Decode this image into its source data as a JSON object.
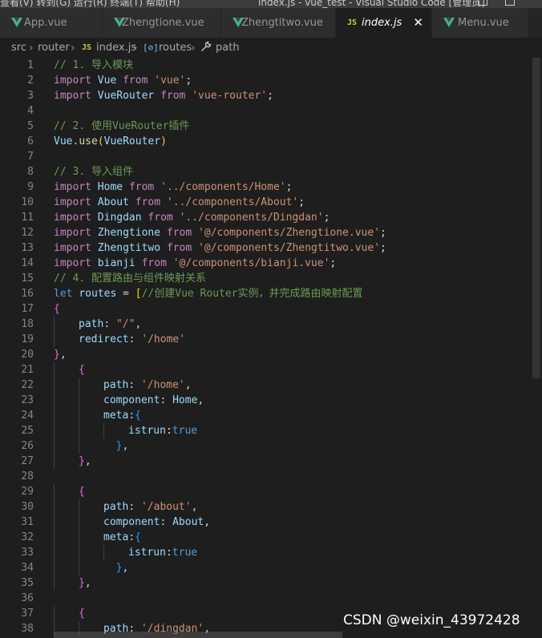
{
  "titlebar": {
    "menu_text": "查看(V)  转到(G)  运行(R)  终端(T)  帮助(H)",
    "window_title": "index.js - vue_test - Visual Studio Code [管理员]"
  },
  "tabs": [
    {
      "label": "App.vue",
      "icon": "vue-icon",
      "active": false
    },
    {
      "label": "Zhengtione.vue",
      "icon": "vue-icon",
      "active": false
    },
    {
      "label": "Zhengtitwo.vue",
      "icon": "vue-icon",
      "active": false
    },
    {
      "label": "index.js",
      "icon": "js-icon",
      "active": true
    },
    {
      "label": "Menu.vue",
      "icon": "vue-icon",
      "active": false
    }
  ],
  "tab_js_badge": "JS",
  "tab_close": "✕",
  "breadcrumb": {
    "src": "src",
    "router": "router",
    "js_badge": "JS",
    "file": "index.js",
    "routes_badge": "[⊘]",
    "routes": "routes",
    "path": "path"
  },
  "colors": {
    "vue_icon": "#41b883",
    "js_icon": "#cbcb41",
    "editor_bg": "#1e1e1e",
    "keyword": "#c586c0",
    "comment": "#6a9955",
    "string": "#ce9178"
  },
  "code_lines": [
    {
      "n": 1,
      "indent": 0,
      "tokens": [
        [
          "cm",
          "// 1. 导入模块"
        ]
      ]
    },
    {
      "n": 2,
      "indent": 0,
      "tokens": [
        [
          "kc",
          "import"
        ],
        [
          "",
          " "
        ],
        [
          "id",
          "Vue"
        ],
        [
          "",
          " "
        ],
        [
          "kc",
          "from"
        ],
        [
          "",
          " "
        ],
        [
          "str",
          "'vue'"
        ],
        [
          "",
          ";"
        ]
      ]
    },
    {
      "n": 3,
      "indent": 0,
      "tokens": [
        [
          "kc",
          "import"
        ],
        [
          "",
          " "
        ],
        [
          "id",
          "VueRouter"
        ],
        [
          "",
          " "
        ],
        [
          "kc",
          "from"
        ],
        [
          "",
          " "
        ],
        [
          "str",
          "'vue-router'"
        ],
        [
          "",
          ";"
        ]
      ]
    },
    {
      "n": 4,
      "indent": 0,
      "tokens": []
    },
    {
      "n": 5,
      "indent": 0,
      "tokens": [
        [
          "cm",
          "// 2. 使用VueRouter插件"
        ]
      ]
    },
    {
      "n": 6,
      "indent": 0,
      "tokens": [
        [
          "id",
          "Vue"
        ],
        [
          "",
          "."
        ],
        [
          "fn",
          "use"
        ],
        [
          "br1",
          "("
        ],
        [
          "id",
          "VueRouter"
        ],
        [
          "br1",
          ")"
        ]
      ]
    },
    {
      "n": 7,
      "indent": 0,
      "tokens": []
    },
    {
      "n": 8,
      "indent": 0,
      "tokens": [
        [
          "cm",
          "// 3. 导入组件"
        ]
      ]
    },
    {
      "n": 9,
      "indent": 0,
      "tokens": [
        [
          "kc",
          "import"
        ],
        [
          "",
          " "
        ],
        [
          "id",
          "Home"
        ],
        [
          "",
          " "
        ],
        [
          "kc",
          "from"
        ],
        [
          "",
          " "
        ],
        [
          "str",
          "'../components/Home'"
        ],
        [
          "",
          ";"
        ]
      ]
    },
    {
      "n": 10,
      "indent": 0,
      "tokens": [
        [
          "kc",
          "import"
        ],
        [
          "",
          " "
        ],
        [
          "id",
          "About"
        ],
        [
          "",
          " "
        ],
        [
          "kc",
          "from"
        ],
        [
          "",
          " "
        ],
        [
          "str",
          "'../components/About'"
        ],
        [
          "",
          ";"
        ]
      ]
    },
    {
      "n": 11,
      "indent": 0,
      "tokens": [
        [
          "kc",
          "import"
        ],
        [
          "",
          " "
        ],
        [
          "id",
          "Dingdan"
        ],
        [
          "",
          " "
        ],
        [
          "kc",
          "from"
        ],
        [
          "",
          " "
        ],
        [
          "str",
          "'../components/Dingdan'"
        ],
        [
          "",
          ";"
        ]
      ]
    },
    {
      "n": 12,
      "indent": 0,
      "tokens": [
        [
          "kc",
          "import"
        ],
        [
          "",
          " "
        ],
        [
          "id",
          "Zhengtione"
        ],
        [
          "",
          " "
        ],
        [
          "kc",
          "from"
        ],
        [
          "",
          " "
        ],
        [
          "str",
          "'@/components/Zhengtione.vue'"
        ],
        [
          "",
          ";"
        ]
      ]
    },
    {
      "n": 13,
      "indent": 0,
      "tokens": [
        [
          "kc",
          "import"
        ],
        [
          "",
          " "
        ],
        [
          "id",
          "Zhengtitwo"
        ],
        [
          "",
          " "
        ],
        [
          "kc",
          "from"
        ],
        [
          "",
          " "
        ],
        [
          "str",
          "'@/components/Zhengtitwo.vue'"
        ],
        [
          "",
          ";"
        ]
      ]
    },
    {
      "n": 14,
      "indent": 0,
      "tokens": [
        [
          "kc",
          "import"
        ],
        [
          "",
          " "
        ],
        [
          "id",
          "bianji"
        ],
        [
          "",
          " "
        ],
        [
          "kc",
          "from"
        ],
        [
          "",
          " "
        ],
        [
          "str",
          "'@/components/bianji.vue'"
        ],
        [
          "",
          ";"
        ]
      ]
    },
    {
      "n": 15,
      "indent": 0,
      "tokens": [
        [
          "cm",
          "// 4. 配置路由与组件映射关系"
        ]
      ]
    },
    {
      "n": 16,
      "indent": 0,
      "tokens": [
        [
          "kw",
          "let"
        ],
        [
          "",
          " "
        ],
        [
          "id",
          "routes"
        ],
        [
          "",
          " = "
        ],
        [
          "br1",
          "["
        ],
        [
          "cm",
          "//创建Vue Router实例，并完成路由映射配置"
        ]
      ]
    },
    {
      "n": 17,
      "indent": 0,
      "tokens": [
        [
          "br2",
          "{"
        ]
      ]
    },
    {
      "n": 18,
      "indent": 1,
      "tokens": [
        [
          "id",
          "path"
        ],
        [
          "",
          ": "
        ],
        [
          "str",
          "\"/\""
        ],
        [
          "",
          ","
        ]
      ]
    },
    {
      "n": 19,
      "indent": 1,
      "tokens": [
        [
          "id",
          "redirect"
        ],
        [
          "",
          ": "
        ],
        [
          "str",
          "'/home'"
        ]
      ]
    },
    {
      "n": 20,
      "indent": 0,
      "tokens": [
        [
          "br2",
          "}"
        ],
        [
          "",
          ","
        ]
      ]
    },
    {
      "n": 21,
      "indent": 1,
      "tokens": [
        [
          "br2",
          "{"
        ]
      ]
    },
    {
      "n": 22,
      "indent": 2,
      "tokens": [
        [
          "id",
          "path"
        ],
        [
          "",
          ": "
        ],
        [
          "str",
          "'/home'"
        ],
        [
          "",
          ","
        ]
      ]
    },
    {
      "n": 23,
      "indent": 2,
      "tokens": [
        [
          "id",
          "component"
        ],
        [
          "",
          ": "
        ],
        [
          "id",
          "Home"
        ],
        [
          "",
          ","
        ]
      ]
    },
    {
      "n": 24,
      "indent": 2,
      "tokens": [
        [
          "id",
          "meta"
        ],
        [
          "",
          ":"
        ],
        [
          "br3",
          "{"
        ]
      ]
    },
    {
      "n": 25,
      "indent": 3,
      "tokens": [
        [
          "id",
          "istrun"
        ],
        [
          "",
          ":"
        ],
        [
          "kw",
          "true"
        ]
      ]
    },
    {
      "n": 26,
      "indent": 2,
      "tokens": [
        [
          "",
          "  "
        ],
        [
          "br3",
          "}"
        ],
        [
          "",
          ","
        ]
      ]
    },
    {
      "n": 27,
      "indent": 1,
      "tokens": [
        [
          "br2",
          "}"
        ],
        [
          "",
          ","
        ]
      ]
    },
    {
      "n": 28,
      "indent": 0,
      "tokens": []
    },
    {
      "n": 29,
      "indent": 1,
      "tokens": [
        [
          "br2",
          "{"
        ]
      ]
    },
    {
      "n": 30,
      "indent": 2,
      "tokens": [
        [
          "id",
          "path"
        ],
        [
          "",
          ": "
        ],
        [
          "str",
          "'/about'"
        ],
        [
          "",
          ","
        ]
      ]
    },
    {
      "n": 31,
      "indent": 2,
      "tokens": [
        [
          "id",
          "component"
        ],
        [
          "",
          ": "
        ],
        [
          "id",
          "About"
        ],
        [
          "",
          ","
        ]
      ]
    },
    {
      "n": 32,
      "indent": 2,
      "tokens": [
        [
          "id",
          "meta"
        ],
        [
          "",
          ":"
        ],
        [
          "br3",
          "{"
        ]
      ]
    },
    {
      "n": 33,
      "indent": 3,
      "tokens": [
        [
          "id",
          "istrun"
        ],
        [
          "",
          ":"
        ],
        [
          "kw",
          "true"
        ]
      ]
    },
    {
      "n": 34,
      "indent": 2,
      "tokens": [
        [
          "",
          "  "
        ],
        [
          "br3",
          "}"
        ],
        [
          "",
          ","
        ]
      ]
    },
    {
      "n": 35,
      "indent": 1,
      "tokens": [
        [
          "br2",
          "}"
        ],
        [
          "",
          ","
        ]
      ]
    },
    {
      "n": 36,
      "indent": 0,
      "tokens": []
    },
    {
      "n": 37,
      "indent": 1,
      "tokens": [
        [
          "br2",
          "{"
        ]
      ]
    },
    {
      "n": 38,
      "indent": 2,
      "tokens": [
        [
          "id",
          "path"
        ],
        [
          "",
          ": "
        ],
        [
          "str",
          "'/dingdan'"
        ],
        [
          "",
          ","
        ]
      ]
    }
  ],
  "watermark": "CSDN @weixin_43972428"
}
